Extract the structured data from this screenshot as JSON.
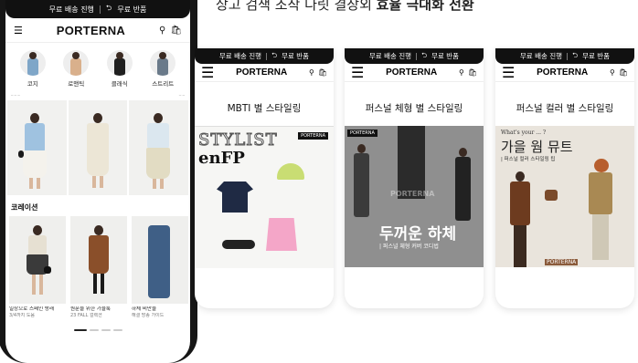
{
  "headline": {
    "prefix": "상고 검색 조작 다릿 결장외 ",
    "bold": "효율 극대화 전환"
  },
  "topbar": {
    "free_ship": "무료 배송 진행",
    "free_return": "무료 반품",
    "return_icon": "return-arrow-icon"
  },
  "brand": "PORTERNA",
  "app_icons": {
    "menu": "menu-icon",
    "search": "search-icon",
    "bag": "bag-icon"
  },
  "categories": [
    {
      "label": "코지",
      "color": "#7fa6c8"
    },
    {
      "label": "로맨틱",
      "color": "#d9b08c"
    },
    {
      "label": "클래식",
      "color": "#1f1f1f"
    },
    {
      "label": "스트리트",
      "color": "#6a7a8a"
    }
  ],
  "section_title": "코레이션",
  "products": [
    {
      "name": "일상으로 스페인 방래",
      "price": "3/4까지 도움"
    },
    {
      "name": "원푼을 위한 가을룩",
      "price": "23 FALL 컬렉션"
    },
    {
      "name": "하체 비만을",
      "price": "해결 방송 가이드"
    }
  ],
  "cards": [
    {
      "title": "MBTI 별 스타일링",
      "art_title": "STYLIST",
      "art_sub": "enFP",
      "tag": "PORTERNA"
    },
    {
      "title": "퍼스널 체형 별 스타일링",
      "art_title": "두꺼운 하체",
      "art_sub": "| 퍼스널 체형 커버 코디법",
      "tag": "PORTERNA",
      "watermark": "PORTERNA"
    },
    {
      "title": "퍼스널 컬러 별 스타일링",
      "art_kicker": "What's your ... ?",
      "art_title": "가을 웜 뮤트",
      "art_sub": "| 퍼스널 컬러 스타일링 팁",
      "tag": "PORTERNA"
    }
  ]
}
